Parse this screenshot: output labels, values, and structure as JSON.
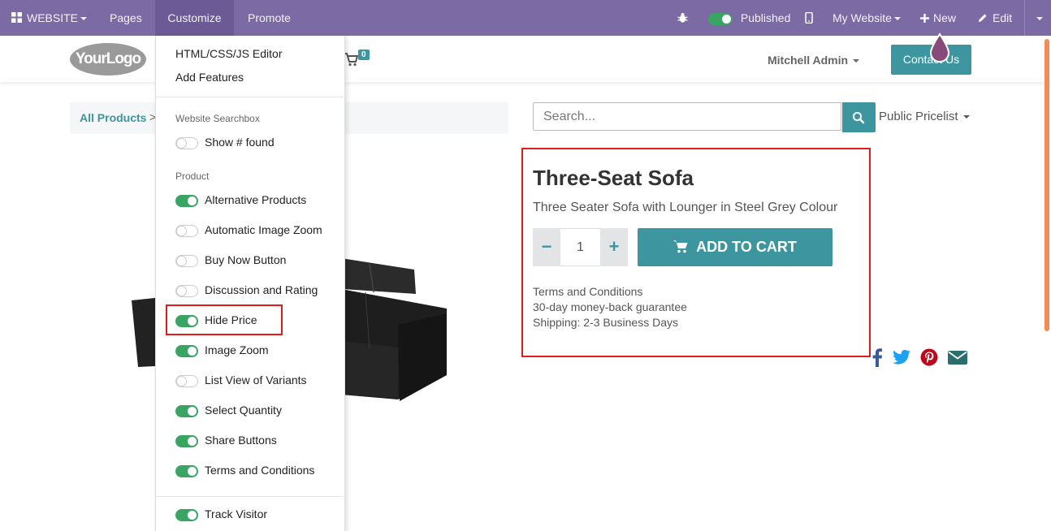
{
  "topbar": {
    "website_label": "WEBSITE",
    "pages_label": "Pages",
    "customize_label": "Customize",
    "promote_label": "Promote",
    "published_label": "Published",
    "my_website_label": "My Website",
    "new_label": "New",
    "edit_label": "Edit"
  },
  "header": {
    "logo_text": "YourLogo",
    "cart_count": "0",
    "user_name": "Mitchell Admin",
    "contact_label": "Contact Us"
  },
  "customize_menu": {
    "editor_label": "HTML/CSS/JS Editor",
    "add_features_label": "Add Features",
    "section_searchbox": "Website Searchbox",
    "show_found": {
      "label": "Show # found",
      "on": false
    },
    "section_product": "Product",
    "options": [
      {
        "label": "Alternative Products",
        "on": true
      },
      {
        "label": "Automatic Image Zoom",
        "on": false
      },
      {
        "label": "Buy Now Button",
        "on": false
      },
      {
        "label": "Discussion and Rating",
        "on": false
      },
      {
        "label": "Hide Price",
        "on": true
      },
      {
        "label": "Image Zoom",
        "on": true
      },
      {
        "label": "List View of Variants",
        "on": false
      },
      {
        "label": "Select Quantity",
        "on": true
      },
      {
        "label": "Share Buttons",
        "on": true
      },
      {
        "label": "Terms and Conditions",
        "on": true
      }
    ],
    "track_visitor": {
      "label": "Track Visitor",
      "on": true
    }
  },
  "breadcrumb": {
    "all_products": "All Products",
    "separator": ">"
  },
  "search": {
    "placeholder": "Search..."
  },
  "pricelist_label": "Public Pricelist",
  "product": {
    "name": "Three-Seat Sofa",
    "description": "Three Seater Sofa with Lounger in Steel Grey Colour",
    "quantity": "1",
    "minus": "−",
    "plus": "+",
    "add_to_cart": "ADD TO CART",
    "terms": [
      "Terms and Conditions",
      "30-day money-back guarantee",
      "Shipping: 2-3 Business Days"
    ]
  },
  "share_icons": [
    "facebook-icon",
    "twitter-icon",
    "pinterest-icon",
    "envelope-icon"
  ],
  "colors": {
    "topbar": "#7c6aa5",
    "accent": "#3c959f",
    "toggle_on": "#3aa463",
    "highlight": "#e21b1b"
  }
}
